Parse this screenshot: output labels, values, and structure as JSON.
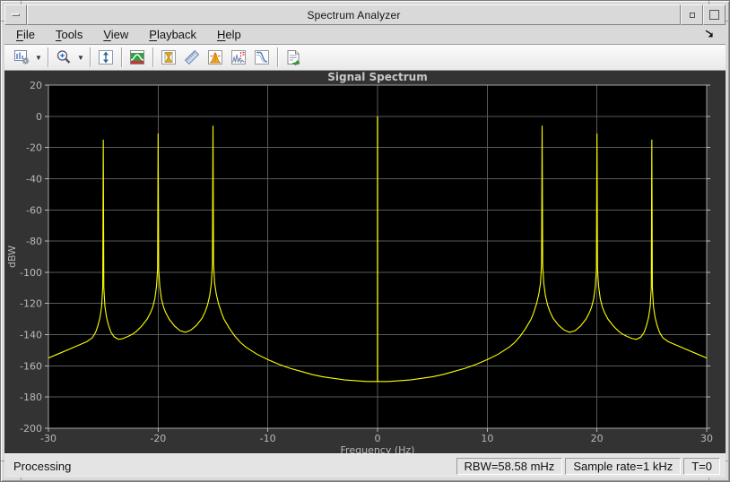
{
  "window": {
    "title": "Spectrum Analyzer",
    "titlebar_icons": [
      "window-menu",
      "minimize",
      "maximize"
    ]
  },
  "menu": {
    "items": [
      {
        "label": "File",
        "mnemonic": "F"
      },
      {
        "label": "Tools",
        "mnemonic": "T"
      },
      {
        "label": "View",
        "mnemonic": "V"
      },
      {
        "label": "Playback",
        "mnemonic": "P"
      },
      {
        "label": "Help",
        "mnemonic": "H"
      }
    ],
    "overflow_icon": "menu-overflow-arrow"
  },
  "toolbar": {
    "icons": [
      "configuration",
      "configuration-dropdown",
      "zoom-in",
      "zoom-dropdown",
      "autoscale-y-limits",
      "spectrum-settings",
      "cursor-measurements",
      "ruler-measure",
      "peak-finder",
      "distortion-measurements",
      "ccdf-measurements",
      "generate-script"
    ]
  },
  "figure": {
    "title": "Signal Spectrum"
  },
  "chart_data": {
    "type": "line",
    "title": "Signal Spectrum",
    "xlabel": "Frequency (Hz)",
    "ylabel": "dBW",
    "xlim": [
      -30,
      30
    ],
    "ylim": [
      -200,
      20
    ],
    "xticks": [
      -30,
      -20,
      -10,
      0,
      10,
      20,
      30
    ],
    "yticks": [
      20,
      0,
      -20,
      -40,
      -60,
      -80,
      -100,
      -120,
      -140,
      -160,
      -180,
      -200
    ],
    "grid": true,
    "colors": {
      "trace": "#ffff00",
      "plot_bg": "#000000",
      "figure_bg": "#333333",
      "grid": "#5a5a5a",
      "axis_border": "#a6a6a6",
      "labels": "#b8b8b8",
      "title": "#c8c8c8"
    },
    "peaks": [
      {
        "frequency_hz": -25,
        "level_dbw": -15
      },
      {
        "frequency_hz": -20,
        "level_dbw": -11
      },
      {
        "frequency_hz": -15,
        "level_dbw": -6
      },
      {
        "frequency_hz": 0,
        "level_dbw": 0
      },
      {
        "frequency_hz": 15,
        "level_dbw": -6
      },
      {
        "frequency_hz": 20,
        "level_dbw": -11
      },
      {
        "frequency_hz": 25,
        "level_dbw": -15
      }
    ],
    "impulse": {
      "frequency_hz": 0,
      "top_dbw": 0,
      "base_dbw": -170
    },
    "trace_points": [
      [
        -30,
        -155
      ],
      [
        -29,
        -152
      ],
      [
        -28,
        -149
      ],
      [
        -27,
        -146
      ],
      [
        -26.5,
        -144.5
      ],
      [
        -26,
        -142
      ],
      [
        -25.7,
        -138.5
      ],
      [
        -25.5,
        -134.5
      ],
      [
        -25.3,
        -129
      ],
      [
        -25.15,
        -122
      ],
      [
        -25.05,
        -110
      ],
      [
        -25,
        -15
      ],
      [
        -24.95,
        -110
      ],
      [
        -24.85,
        -122
      ],
      [
        -24.7,
        -129
      ],
      [
        -24.5,
        -134.5
      ],
      [
        -24.3,
        -138.5
      ],
      [
        -24,
        -141.5
      ],
      [
        -23.6,
        -143
      ],
      [
        -23.2,
        -142.5
      ],
      [
        -22.7,
        -141
      ],
      [
        -22.3,
        -139.5
      ],
      [
        -22,
        -138
      ],
      [
        -21.5,
        -134.5
      ],
      [
        -21,
        -130
      ],
      [
        -20.7,
        -126
      ],
      [
        -20.5,
        -122.5
      ],
      [
        -20.3,
        -117
      ],
      [
        -20.15,
        -109
      ],
      [
        -20.05,
        -98
      ],
      [
        -20,
        -11
      ],
      [
        -19.95,
        -98
      ],
      [
        -19.85,
        -109
      ],
      [
        -19.7,
        -117
      ],
      [
        -19.5,
        -122.5
      ],
      [
        -19.3,
        -126
      ],
      [
        -19,
        -130
      ],
      [
        -18.5,
        -134.5
      ],
      [
        -18,
        -137.5
      ],
      [
        -17.5,
        -138.5
      ],
      [
        -17,
        -137
      ],
      [
        -16.5,
        -134
      ],
      [
        -16,
        -129.5
      ],
      [
        -15.7,
        -125
      ],
      [
        -15.5,
        -121
      ],
      [
        -15.3,
        -115
      ],
      [
        -15.15,
        -107
      ],
      [
        -15.05,
        -95
      ],
      [
        -15,
        -6
      ],
      [
        -14.95,
        -95
      ],
      [
        -14.85,
        -107
      ],
      [
        -14.7,
        -114
      ],
      [
        -14.5,
        -120
      ],
      [
        -14.2,
        -126.5
      ],
      [
        -14,
        -130
      ],
      [
        -13.5,
        -136
      ],
      [
        -13,
        -141
      ],
      [
        -12.5,
        -145
      ],
      [
        -12,
        -148
      ],
      [
        -11,
        -152.5
      ],
      [
        -10,
        -156
      ],
      [
        -9,
        -159
      ],
      [
        -8,
        -161.5
      ],
      [
        -7,
        -163.5
      ],
      [
        -6,
        -165.5
      ],
      [
        -5,
        -167
      ],
      [
        -4,
        -168
      ],
      [
        -3,
        -169
      ],
      [
        -2,
        -169.5
      ],
      [
        -1,
        -170
      ],
      [
        0,
        -170
      ],
      [
        1,
        -170
      ],
      [
        2,
        -169.5
      ],
      [
        3,
        -169
      ],
      [
        4,
        -168
      ],
      [
        5,
        -167
      ],
      [
        6,
        -165.5
      ],
      [
        7,
        -163.5
      ],
      [
        8,
        -161.5
      ],
      [
        9,
        -159
      ],
      [
        10,
        -156
      ],
      [
        11,
        -152.5
      ],
      [
        12,
        -148
      ],
      [
        12.5,
        -145
      ],
      [
        13,
        -141
      ],
      [
        13.5,
        -136
      ],
      [
        14,
        -130
      ],
      [
        14.2,
        -126.5
      ],
      [
        14.5,
        -120
      ],
      [
        14.7,
        -114
      ],
      [
        14.85,
        -107
      ],
      [
        14.95,
        -95
      ],
      [
        15,
        -6
      ],
      [
        15.05,
        -95
      ],
      [
        15.15,
        -107
      ],
      [
        15.3,
        -115
      ],
      [
        15.5,
        -121
      ],
      [
        15.7,
        -125
      ],
      [
        16,
        -129.5
      ],
      [
        16.5,
        -134
      ],
      [
        17,
        -137
      ],
      [
        17.5,
        -138.5
      ],
      [
        18,
        -137.5
      ],
      [
        18.5,
        -134.5
      ],
      [
        19,
        -130
      ],
      [
        19.3,
        -126
      ],
      [
        19.5,
        -122.5
      ],
      [
        19.7,
        -117
      ],
      [
        19.85,
        -109
      ],
      [
        19.95,
        -98
      ],
      [
        20,
        -11
      ],
      [
        20.05,
        -98
      ],
      [
        20.15,
        -109
      ],
      [
        20.3,
        -117
      ],
      [
        20.5,
        -122.5
      ],
      [
        20.7,
        -126
      ],
      [
        21,
        -130
      ],
      [
        21.5,
        -134.5
      ],
      [
        22,
        -138
      ],
      [
        22.3,
        -139.5
      ],
      [
        22.7,
        -141
      ],
      [
        23.2,
        -142.5
      ],
      [
        23.6,
        -143
      ],
      [
        24,
        -141.5
      ],
      [
        24.3,
        -138.5
      ],
      [
        24.5,
        -134.5
      ],
      [
        24.7,
        -129
      ],
      [
        24.85,
        -122
      ],
      [
        24.95,
        -110
      ],
      [
        25,
        -15
      ],
      [
        25.05,
        -110
      ],
      [
        25.15,
        -122
      ],
      [
        25.3,
        -129
      ],
      [
        25.5,
        -134.5
      ],
      [
        25.7,
        -138.5
      ],
      [
        26,
        -142
      ],
      [
        26.5,
        -144.5
      ],
      [
        27,
        -146
      ],
      [
        28,
        -149
      ],
      [
        29,
        -152
      ],
      [
        30,
        -155
      ]
    ]
  },
  "statusbar": {
    "status": "Processing",
    "rbw": "RBW=58.58 mHz",
    "sample_rate": "Sample rate=1 kHz",
    "time": "T=0"
  }
}
